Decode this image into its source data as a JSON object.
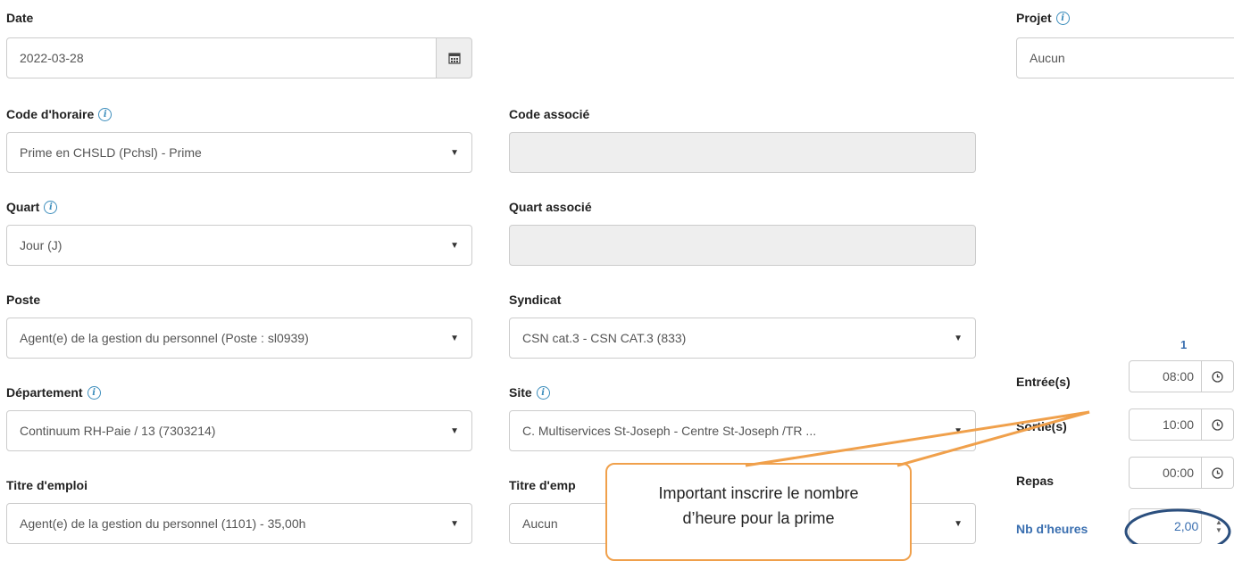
{
  "date": {
    "label": "Date",
    "value": "2022-03-28"
  },
  "projet": {
    "label": "Projet",
    "value": "Aucun"
  },
  "code_horaire": {
    "label": "Code d'horaire",
    "value": "Prime en CHSLD (Pchsl) - Prime"
  },
  "code_associe": {
    "label": "Code associé",
    "value": ""
  },
  "quart": {
    "label": "Quart",
    "value": "Jour (J)"
  },
  "quart_associe": {
    "label": "Quart associé",
    "value": ""
  },
  "poste": {
    "label": "Poste",
    "value": "Agent(e) de la gestion du personnel (Poste : sl0939)"
  },
  "syndicat": {
    "label": "Syndicat",
    "value": "CSN cat.3 - CSN CAT.3 (833)"
  },
  "departement": {
    "label": "Département",
    "value": "Continuum RH-Paie / 13 (7303214)"
  },
  "site": {
    "label": "Site",
    "value": "C. Multiservices St-Joseph - Centre St-Joseph /TR ..."
  },
  "titre_emploi": {
    "label": "Titre d'emploi",
    "value": "Agent(e) de la gestion du personnel (1101) - 35,00h"
  },
  "titre_emploi_2": {
    "label": "Titre d'emp",
    "value": "Aucun"
  },
  "hours": {
    "column": "1",
    "entree": {
      "label": "Entrée(s)",
      "value": "08:00"
    },
    "sortie": {
      "label": "Sortie(s)",
      "value": "10:00"
    },
    "repas": {
      "label": "Repas",
      "value": "00:00"
    },
    "nb_heures": {
      "label": "Nb d'heures",
      "value": "2,00"
    }
  },
  "callout": {
    "line1": "Important inscrire le nombre",
    "line2": "d’heure pour la prime"
  },
  "colors": {
    "callout_border": "#f0a04b",
    "highlight_ring": "#2b4f7e",
    "info_icon": "#3c8dbc"
  }
}
